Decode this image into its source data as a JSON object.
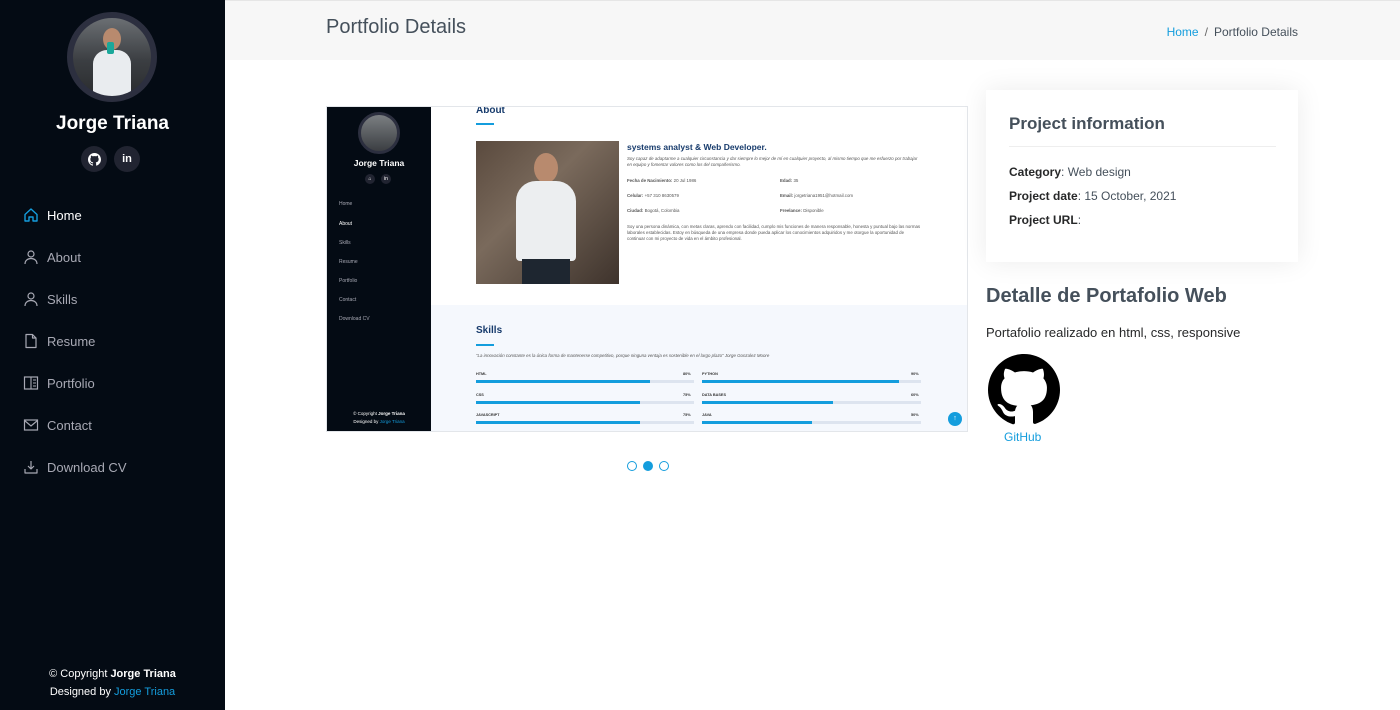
{
  "sidebar": {
    "name": "Jorge Triana",
    "social": [
      "github",
      "in"
    ],
    "nav": [
      {
        "label": "Home",
        "icon": "home-icon",
        "active": true
      },
      {
        "label": "About",
        "icon": "person-icon"
      },
      {
        "label": "Skills",
        "icon": "person-icon"
      },
      {
        "label": "Resume",
        "icon": "file-icon"
      },
      {
        "label": "Portfolio",
        "icon": "book-icon"
      },
      {
        "label": "Contact",
        "icon": "envelope-icon"
      },
      {
        "label": "Download CV",
        "icon": "download-icon"
      }
    ],
    "footer": {
      "copyright_prefix": "© Copyright ",
      "copyright_name": "Jorge Triana",
      "designed_prefix": "Designed by ",
      "designed_name": "Jorge Triana"
    }
  },
  "header": {
    "title": "Portfolio Details",
    "breadcrumb": {
      "home": "Home",
      "separator": "/",
      "current": "Portfolio Details"
    }
  },
  "screenshot": {
    "nav": [
      "Home",
      "About",
      "Skills",
      "Resume",
      "Portfolio",
      "Contact",
      "Download CV"
    ],
    "social": [
      "⌂",
      "in"
    ],
    "about_title": "About",
    "role": "systems analyst & Web Developer.",
    "intro": "Soy capaz de adaptarme a cualquier circunstancia y dar siempre lo mejor de mí en cualquier proyecto, al mismo tiempo que me esfuerzo por trabajar en equipo y fomentar valores como los del compañerismo.",
    "facts": [
      {
        "label": "Fecha de Nacimiento:",
        "value": "20 Jul 1986"
      },
      {
        "label": "Edad:",
        "value": "35"
      },
      {
        "label": "Celular:",
        "value": "+57 310 8630579"
      },
      {
        "label": "Email:",
        "value": "jorgetriana1951@hotmail.com"
      },
      {
        "label": "Ciudad:",
        "value": "Bogotá, Colombia"
      },
      {
        "label": "Freelance:",
        "value": "Disponible"
      }
    ],
    "bio": "Soy una persona dinámica, con metas claras, aprendo con facilidad, cumplo mis funciones de manera responsable, honesta y puntual bajo las normas laborales establecidas. Estoy en búsqueda de una empresa donde pueda aplicar los conocimientos adquiridos y me otorgue la oportunidad de continuar con mi proyecto de vida en el ámbito profesional.",
    "skills_title": "Skills",
    "quote": "\"La innovación constante es la única forma de mantenerse competitivo, porque ninguna ventaja es sostenible en el largo plazo\" Jorge Gonzalez Moore",
    "skills": [
      {
        "name": "HTML",
        "percent": "80%",
        "value": 0.8
      },
      {
        "name": "PYTHON",
        "percent": "90%",
        "value": 0.9
      },
      {
        "name": "CSS",
        "percent": "75%",
        "value": 0.75
      },
      {
        "name": "DATA BASES",
        "percent": "60%",
        "value": 0.6
      },
      {
        "name": "JAVASCRIPT",
        "percent": "75%",
        "value": 0.75
      },
      {
        "name": "JAVA",
        "percent": "50%",
        "value": 0.5
      }
    ],
    "footer_prefix": "© Copyright ",
    "footer_name": "Jorge Triana",
    "designed_prefix": "Designed by ",
    "designed_name": "Jorge Triana",
    "top_button": "↑"
  },
  "slider": {
    "count": 3,
    "active_index": 1
  },
  "project_info": {
    "title": "Project information",
    "category_label": "Category",
    "category_value": "Web design",
    "date_label": "Project date",
    "date_value": "15 October, 2021",
    "url_label": "Project URL",
    "url_value": ""
  },
  "detail": {
    "title": "Detalle de Portafolio Web",
    "description": "Portafolio realizado en html, css, responsive",
    "github_label": "GitHub"
  },
  "colors": {
    "accent": "#149ddd",
    "sidebar_bg": "#040b14",
    "heading": "#45505b"
  }
}
